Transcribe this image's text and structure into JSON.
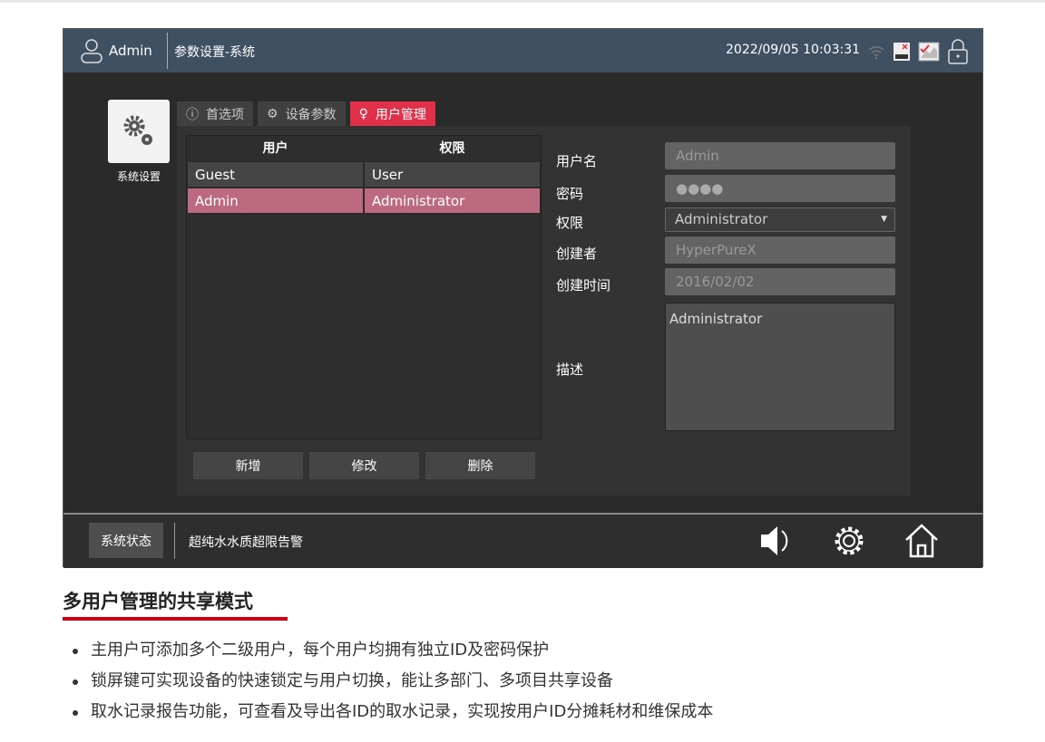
{
  "header": {
    "user": "Admin",
    "title": "参数设置-系统",
    "datetime": "2022/09/05 10:03:31"
  },
  "sidebar": {
    "label": "系统设置"
  },
  "tabs": [
    {
      "label": "首选项",
      "icon": "info-icon"
    },
    {
      "label": "设备参数",
      "icon": "gear-icon"
    },
    {
      "label": "用户管理",
      "icon": "user-icon"
    }
  ],
  "table": {
    "headers": [
      "用户",
      "权限"
    ],
    "rows": [
      [
        "Guest",
        "User"
      ],
      [
        "Admin",
        "Administrator"
      ]
    ]
  },
  "buttons": {
    "add": "新增",
    "edit": "修改",
    "delete": "删除"
  },
  "form": {
    "username_label": "用户名",
    "username": "Admin",
    "password_label": "密码",
    "password": "●●●●",
    "role_label": "权限",
    "role": "Administrator",
    "creator_label": "创建者",
    "creator": "HyperPureX",
    "created_label": "创建时间",
    "created": "2016/02/02",
    "desc_label": "描述",
    "desc": "Administrator"
  },
  "bottom": {
    "status": "系统状态",
    "alarm": "超纯水水质超限告警"
  },
  "article": {
    "heading": "多用户管理的共享模式",
    "bullets": [
      "主用户可添加多个二级用户，每个用户均拥有独立ID及密码保护",
      "锁屏键可实现设备的快速锁定与用户切换，能让多部门、多项目共享设备",
      "取水记录报告功能，可查看及导出各ID的取水记录，实现按用户ID分摊耗材和维保成本"
    ]
  }
}
